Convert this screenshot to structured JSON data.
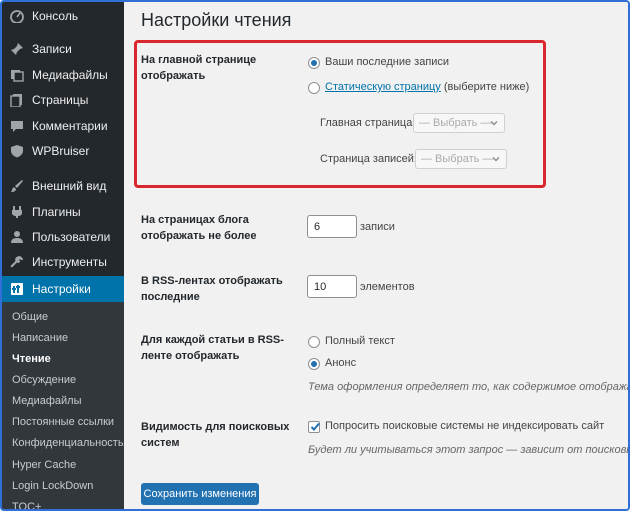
{
  "sidebar": {
    "items": [
      {
        "label": "Консоль",
        "icon": "dashboard-icon"
      },
      {
        "label": "Записи",
        "icon": "pin-icon"
      },
      {
        "label": "Медиафайлы",
        "icon": "media-icon"
      },
      {
        "label": "Страницы",
        "icon": "pages-icon"
      },
      {
        "label": "Комментарии",
        "icon": "comment-icon"
      },
      {
        "label": "WPBruiser",
        "icon": "shield-icon"
      },
      {
        "label": "Внешний вид",
        "icon": "brush-icon"
      },
      {
        "label": "Плагины",
        "icon": "plugin-icon"
      },
      {
        "label": "Пользователи",
        "icon": "user-icon"
      },
      {
        "label": "Инструменты",
        "icon": "wrench-icon"
      },
      {
        "label": "Настройки",
        "icon": "settings-icon"
      }
    ],
    "submenu": [
      "Общие",
      "Написание",
      "Чтение",
      "Обсуждение",
      "Медиафайлы",
      "Постоянные ссылки",
      "Конфиденциальность",
      "Hyper Cache",
      "Login LockDown",
      "TOC+"
    ]
  },
  "page": {
    "title": "Настройки чтения",
    "front_page": {
      "label_line1": "На главной странице",
      "label_line2": "отображать",
      "option_latest": "Ваши последние записи",
      "option_static_link": "Статическую страницу",
      "option_static_suffix": "(выберите ниже)",
      "homepage_label": "Главная страница:",
      "homepage_value": "— Выбрать —",
      "posts_page_label": "Страница записей:",
      "posts_page_value": "— Выбрать —"
    },
    "posts_per_page": {
      "label_line1": "На страницах блога",
      "label_line2": "отображать не более",
      "value": "6",
      "unit": "записи"
    },
    "rss_count": {
      "label_line1": "В RSS-лентах отображать",
      "label_line2": "последние",
      "value": "10",
      "unit": "элементов"
    },
    "rss_content": {
      "label_line1": "Для каждой статьи в RSS-",
      "label_line2": "ленте отображать",
      "option_full": "Полный текст",
      "option_summary": "Анонс",
      "description": "Тема оформления определяет то, как содержимое отображается"
    },
    "search_visibility": {
      "label_line1": "Видимость для поисковых",
      "label_line2": "систем",
      "checkbox_label": "Попросить поисковые системы не индексировать сайт",
      "description": "Будет ли учитываться этот запрос — зависит от поисковых систем"
    },
    "save_label": "Сохранить изменения"
  },
  "colors": {
    "accent": "#0073aa",
    "highlight": "#d9272e",
    "sidebar": "#23282d"
  }
}
